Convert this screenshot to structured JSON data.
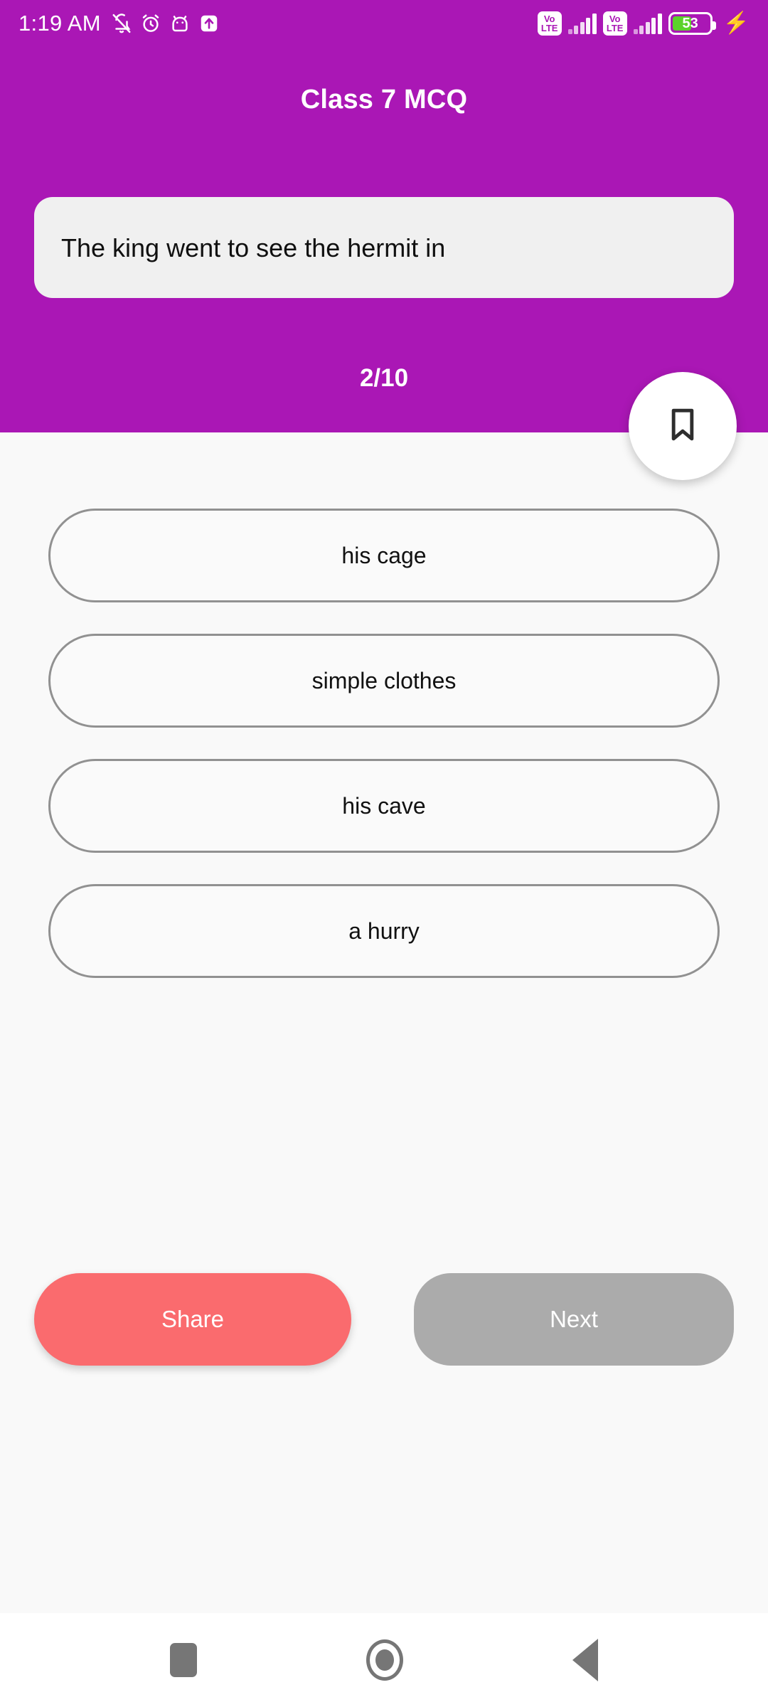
{
  "status_bar": {
    "time": "1:19 AM",
    "left_icons": [
      "bell-muted-icon",
      "alarm-clock-icon",
      "android-head-icon",
      "upload-arrow-icon"
    ],
    "sim1_network": {
      "top": "Vo",
      "bottom": "LTE"
    },
    "sim2_network": {
      "top": "Vo",
      "bottom": "LTE"
    },
    "battery_percent": "53",
    "battery_fill_pct": 53,
    "charging": true,
    "battery_color": "#5BD22B"
  },
  "header": {
    "title": "Class 7 MCQ",
    "background_color": "#AA17B5",
    "text_color": "#FFFFFF"
  },
  "question": {
    "text": "The king went to see the hermit in",
    "card_color": "#F0F0F0"
  },
  "progress": {
    "counter": "2/10",
    "current": 2,
    "total": 10
  },
  "bookmark": {
    "icon": "bookmark-icon",
    "background_color": "#FFFFFF",
    "icon_color": "#2E2E2E"
  },
  "options": [
    {
      "label": "his cage"
    },
    {
      "label": "simple clothes"
    },
    {
      "label": "his cave"
    },
    {
      "label": "a hurry"
    }
  ],
  "options_style": {
    "border_color": "#919191",
    "text_color": "#111111"
  },
  "actions": {
    "share_label": "Share",
    "share_color": "#FA6B6E",
    "next_label": "Next",
    "next_color": "#ABABAB"
  },
  "nav_bar": {
    "recents": "recents-square-icon",
    "home": "home-circle-icon",
    "back": "back-triangle-icon",
    "icon_color": "#767676"
  }
}
